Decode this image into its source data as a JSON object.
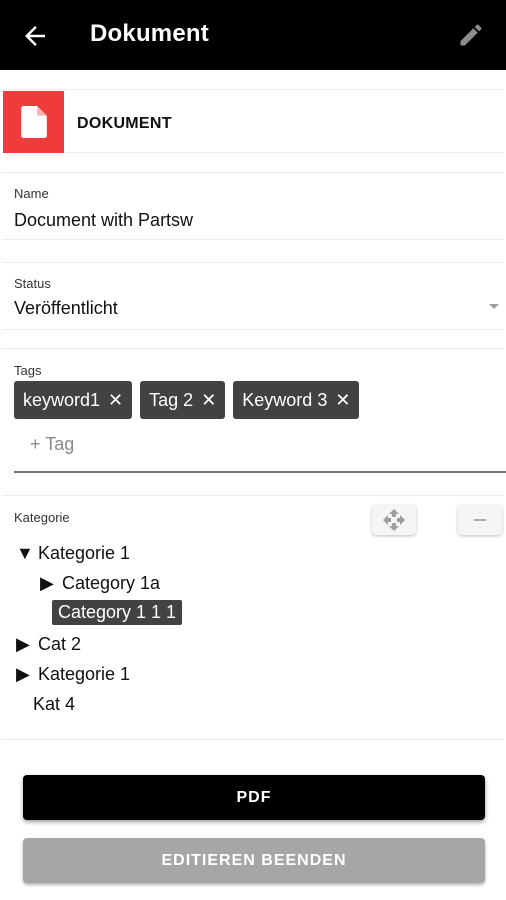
{
  "appbar": {
    "title": "Dokument",
    "back_icon": "arrow-left-icon",
    "edit_icon": "pencil-icon"
  },
  "document": {
    "type_label": "DOKUMENT",
    "icon": "document-icon",
    "icon_color": "#ef3b3b"
  },
  "name": {
    "label": "Name",
    "value": "Document with Partsw"
  },
  "status": {
    "label": "Status",
    "value": "Veröffentlicht"
  },
  "tags": {
    "label": "Tags",
    "items": [
      "keyword1",
      "Tag 2",
      "Keyword 3"
    ],
    "remove_glyph": "✕",
    "add_placeholder": "+ Tag"
  },
  "kategorie": {
    "label": "Kategorie",
    "move_icon": "move-icon",
    "remove_icon": "minus-icon",
    "tree": [
      {
        "label": "Kategorie 1",
        "expander": "▼"
      },
      {
        "label": "Category 1a",
        "expander": "▶"
      },
      {
        "label": "Category 1 1 1",
        "expander": ""
      },
      {
        "label": "Cat 2",
        "expander": "▶"
      },
      {
        "label": "Kategorie 1",
        "expander": "▶"
      },
      {
        "label": "Kat 4",
        "expander": ""
      }
    ]
  },
  "buttons": {
    "pdf": "PDF",
    "finish_edit": "EDITIEREN BEENDEN"
  }
}
